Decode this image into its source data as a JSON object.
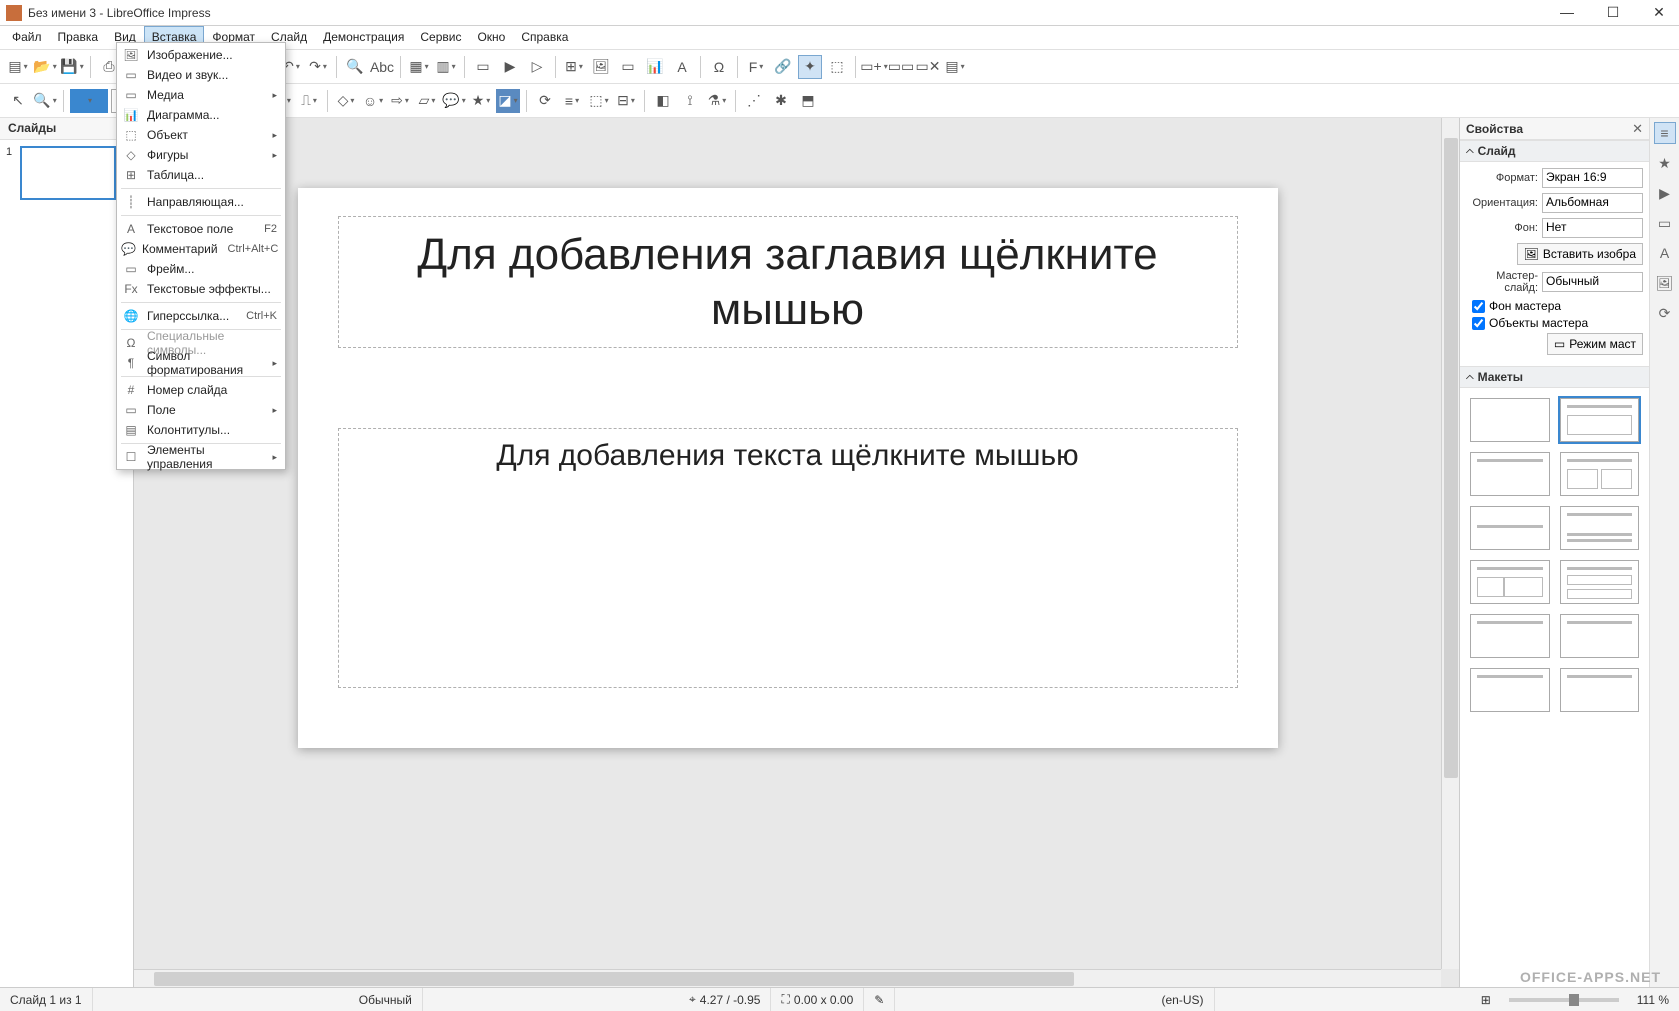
{
  "window": {
    "title": "Без имени 3 - LibreOffice Impress"
  },
  "menubar": {
    "items": [
      "Файл",
      "Правка",
      "Вид",
      "Вставка",
      "Формат",
      "Слайд",
      "Демонстрация",
      "Сервис",
      "Окно",
      "Справка"
    ],
    "open_index": 3
  },
  "insert_menu": {
    "items": [
      {
        "icon": "image-icon",
        "label": "Изображение...",
        "shortcut": "",
        "submenu": false
      },
      {
        "icon": "video-icon",
        "label": "Видео и звук...",
        "shortcut": "",
        "submenu": false
      },
      {
        "icon": "media-icon",
        "label": "Медиа",
        "shortcut": "",
        "submenu": true
      },
      {
        "icon": "chart-icon",
        "label": "Диаграмма...",
        "shortcut": "",
        "submenu": false
      },
      {
        "icon": "object-icon",
        "label": "Объект",
        "shortcut": "",
        "submenu": true
      },
      {
        "icon": "shapes-icon",
        "label": "Фигуры",
        "shortcut": "",
        "submenu": true
      },
      {
        "icon": "table-icon",
        "label": "Таблица...",
        "shortcut": "",
        "submenu": false
      },
      {
        "sep": true
      },
      {
        "icon": "guide-icon",
        "label": "Направляющая...",
        "shortcut": "",
        "submenu": false
      },
      {
        "sep": true
      },
      {
        "icon": "textbox-icon",
        "label": "Текстовое поле",
        "shortcut": "F2",
        "submenu": false
      },
      {
        "icon": "comment-icon",
        "label": "Комментарий",
        "shortcut": "Ctrl+Alt+C",
        "submenu": false
      },
      {
        "icon": "frame-icon",
        "label": "Фрейм...",
        "shortcut": "",
        "submenu": false
      },
      {
        "icon": "texteffects-icon",
        "label": "Текстовые эффекты...",
        "shortcut": "",
        "submenu": false
      },
      {
        "sep": true
      },
      {
        "icon": "hyperlink-icon",
        "label": "Гиперссылка...",
        "shortcut": "Ctrl+K",
        "submenu": false
      },
      {
        "sep": true
      },
      {
        "icon": "specialchar-icon",
        "label": "Специальные символы...",
        "shortcut": "",
        "submenu": false,
        "disabled": true
      },
      {
        "icon": "formatmark-icon",
        "label": "Символ форматирования",
        "shortcut": "",
        "submenu": true
      },
      {
        "sep": true
      },
      {
        "icon": "slidenum-icon",
        "label": "Номер слайда",
        "shortcut": "",
        "submenu": false
      },
      {
        "icon": "field-icon",
        "label": "Поле",
        "shortcut": "",
        "submenu": true
      },
      {
        "icon": "headerfooter-icon",
        "label": "Колонтитулы...",
        "shortcut": "",
        "submenu": false
      },
      {
        "sep": true
      },
      {
        "icon": "controls-icon",
        "label": "Элементы управления",
        "shortcut": "",
        "submenu": true
      }
    ]
  },
  "slide_panel": {
    "header": "Слайды",
    "slides": [
      {
        "num": "1"
      }
    ]
  },
  "canvas": {
    "title_placeholder": "Для добавления заглавия щёлкните мышью",
    "body_placeholder": "Для добавления текста щёлкните мышью"
  },
  "properties": {
    "panel_title": "Свойства",
    "slide_section": "Слайд",
    "format_label": "Формат:",
    "format_value": "Экран 16:9",
    "orientation_label": "Ориентация:",
    "orientation_value": "Альбомная",
    "background_label": "Фон:",
    "background_value": "Нет",
    "insert_image_btn": "Вставить изобра",
    "master_label": "Мастер-слайд:",
    "master_value": "Обычный",
    "master_bg_chk": "Фон мастера",
    "master_obj_chk": "Объекты мастера",
    "master_mode_btn": "Режим маст",
    "layouts_section": "Макеты"
  },
  "statusbar": {
    "slide_pos": "Слайд 1 из 1",
    "template": "Обычный",
    "coords": "4.27 / -0.95",
    "size": "0.00 x 0.00",
    "lang": "(en-US)",
    "zoom": "111 %"
  },
  "watermark": "OFFICE-APPS.NET"
}
